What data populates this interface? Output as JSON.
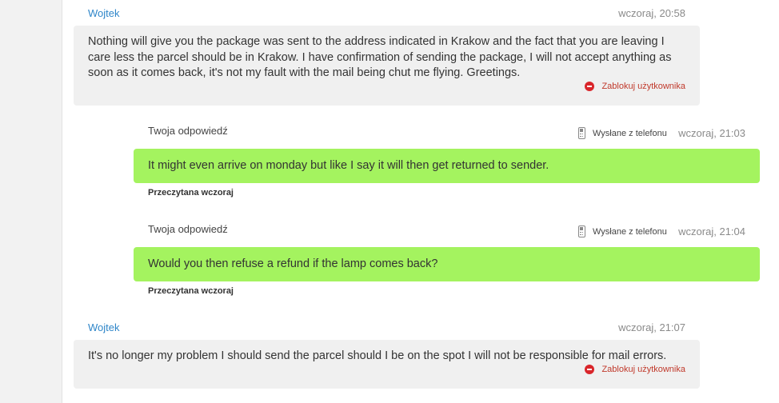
{
  "messages": [
    {
      "sender": "Wojtek",
      "time": "wczoraj, 20:58",
      "text": "Nothing will give you the package was sent to the address indicated in Krakow and the fact that you are leaving I care less the parcel should be in Krakow. I have confirmation of sending the package, I will not accept anything as soon as it comes back, it's not my fault with the mail being chut me flying. Greetings.",
      "block_label": "Zablokuj użytkownika"
    },
    {
      "reply_label": "Twoja odpowiedź",
      "sent_from": "Wysłane z telefonu",
      "time": "wczoraj, 21:03",
      "text": "It might even arrive on monday but like I say it will then get returned to sender.",
      "status": "Przeczytana wczoraj"
    },
    {
      "reply_label": "Twoja odpowiedź",
      "sent_from": "Wysłane z telefonu",
      "time": "wczoraj, 21:04",
      "text": "Would you then refuse a refund if the lamp comes back?",
      "status": "Przeczytana wczoraj"
    },
    {
      "sender": "Wojtek",
      "time": "wczoraj, 21:07",
      "text": "It's no longer my problem I should send the parcel should I be on the spot I will not be responsible for mail errors.",
      "block_label": "Zablokuj użytkownika"
    }
  ],
  "colors": {
    "outgoing_bubble": "#a4f35f",
    "incoming_bubble": "#f0f0f0",
    "sender_name": "#2f86c9",
    "block_link": "#c0392b"
  }
}
